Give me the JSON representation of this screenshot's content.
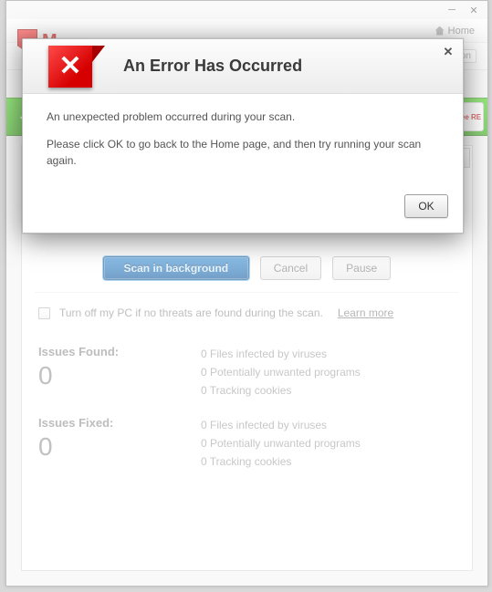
{
  "window": {
    "home_label": "Home",
    "option_label": "tion",
    "free_chip": "ee\nRE"
  },
  "actions": {
    "scan_bg": "Scan in background",
    "cancel": "Cancel",
    "pause": "Pause"
  },
  "options": {
    "turnoff_label": "Turn off my PC if no threats are found during the scan.",
    "learn_more": "Learn more"
  },
  "issues_found": {
    "heading": "Issues Found:",
    "count": "0",
    "lines": [
      "0 Files infected by viruses",
      "0 Potentially unwanted programs",
      "0 Tracking cookies"
    ]
  },
  "issues_fixed": {
    "heading": "Issues Fixed:",
    "count": "0",
    "lines": [
      "0 Files infected by viruses",
      "0 Potentially unwanted programs",
      "0 Tracking cookies"
    ]
  },
  "modal": {
    "title": "An Error Has Occurred",
    "line1": "An unexpected problem occurred during your scan.",
    "line2": "Please click OK to go back to the Home page, and then try running your scan again.",
    "ok": "OK"
  }
}
